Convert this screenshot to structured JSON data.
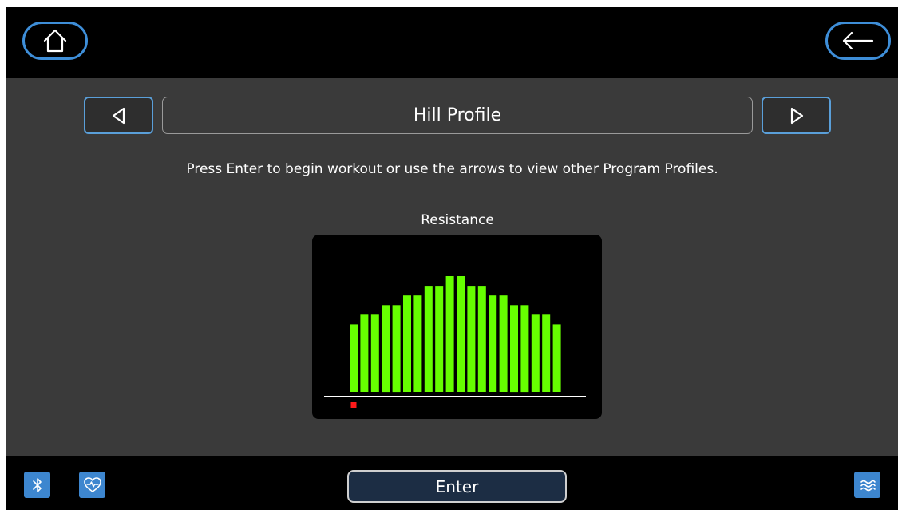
{
  "header": {
    "home_icon": "home-icon",
    "back_icon": "back-arrow-icon"
  },
  "program": {
    "title": "Hill Profile",
    "prev_icon": "triangle-left-icon",
    "next_icon": "triangle-right-icon",
    "instruction": "Press Enter to begin workout or use the arrows to view other Program Profiles."
  },
  "chart_data": {
    "type": "bar",
    "title": "Resistance",
    "values": [
      7,
      8,
      8,
      9,
      9,
      10,
      10,
      11,
      11,
      12,
      12,
      11,
      11,
      10,
      10,
      9,
      9,
      8,
      8,
      7
    ],
    "ylim": [
      0,
      12
    ],
    "bar_color": "#66ff00",
    "current_segment": 1,
    "current_marker_color": "#ff1a1a"
  },
  "footer": {
    "enter_label": "Enter",
    "bluetooth_icon": "bluetooth-icon",
    "heart_rate_icon": "heart-rate-icon",
    "menu_icon": "menu-waves-icon"
  },
  "colors": {
    "accent": "#3e8ed8",
    "background": "#3a3a3a",
    "bar": "#66ff00"
  }
}
